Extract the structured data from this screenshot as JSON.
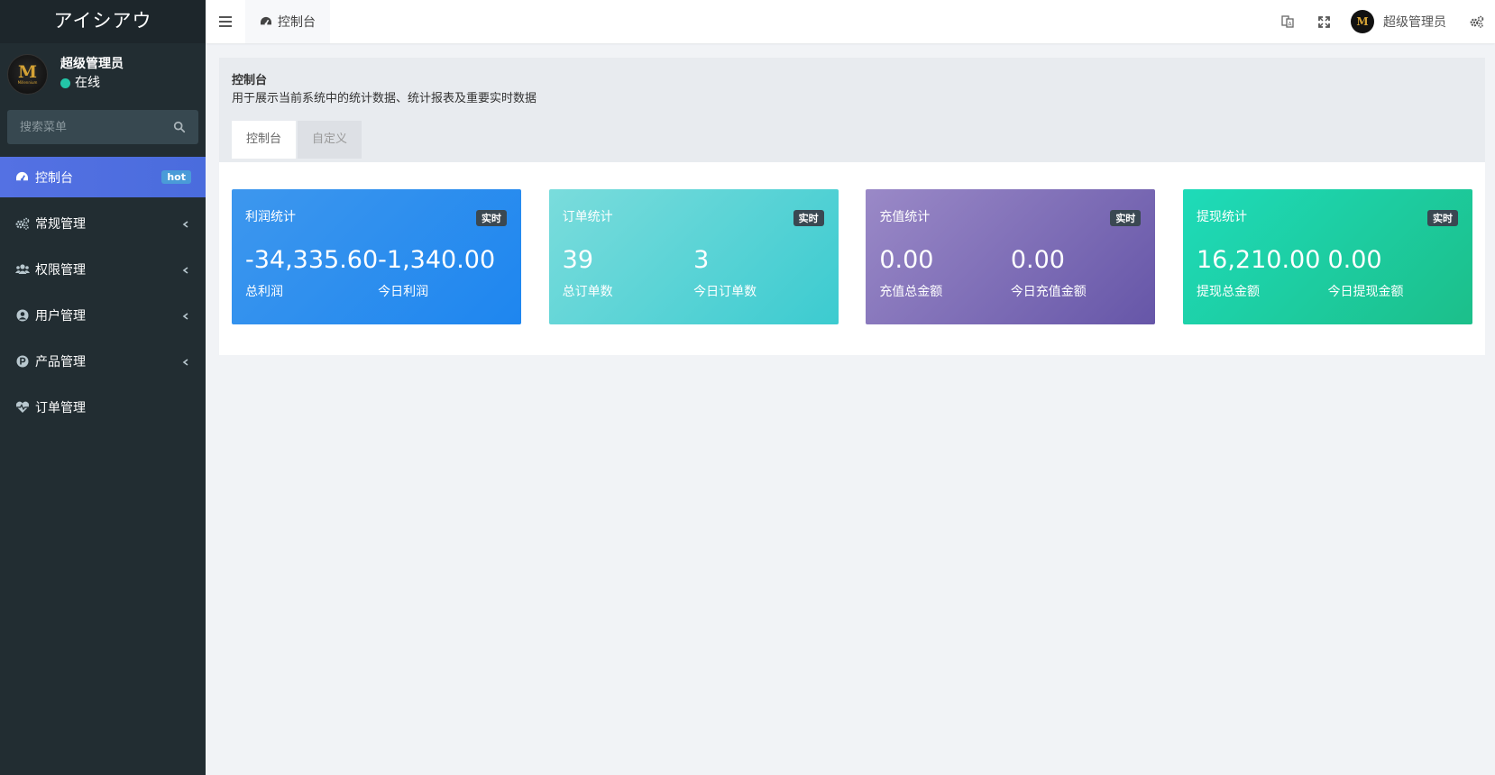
{
  "app": {
    "title": "アイシアウ"
  },
  "user": {
    "name": "超级管理员",
    "status": "在线",
    "avatar_letter": "M",
    "avatar_subtext": "Millennium"
  },
  "search": {
    "placeholder": "搜索菜单"
  },
  "sidebar": {
    "items": [
      {
        "label": "控制台",
        "icon": "dashboard-icon",
        "badge": "hot",
        "active": true
      },
      {
        "label": "常规管理",
        "icon": "cogs-icon",
        "has_children": true
      },
      {
        "label": "权限管理",
        "icon": "group-icon",
        "has_children": true
      },
      {
        "label": "用户管理",
        "icon": "user-circle-icon",
        "has_children": true
      },
      {
        "label": "产品管理",
        "icon": "product-p-icon",
        "has_children": true
      },
      {
        "label": "订单管理",
        "icon": "heartbeat-icon"
      }
    ]
  },
  "header": {
    "tab_label": "控制台",
    "user_name": "超级管理员"
  },
  "panel": {
    "title": "控制台",
    "description": "用于展示当前系统中的统计数据、统计报表及重要实时数据",
    "tabs": [
      "控制台",
      "自定义"
    ]
  },
  "cards": [
    {
      "title": "利润统计",
      "tag": "实时",
      "stats": [
        {
          "value": "-34,335.60",
          "label": "总利润"
        },
        {
          "value": "-1,340.00",
          "label": "今日利润"
        }
      ],
      "color": "#2a8ef0"
    },
    {
      "title": "订单统计",
      "tag": "实时",
      "stats": [
        {
          "value": "39",
          "label": "总订单数"
        },
        {
          "value": "3",
          "label": "今日订单数"
        }
      ],
      "color": "#4ccfd3"
    },
    {
      "title": "充值统计",
      "tag": "实时",
      "stats": [
        {
          "value": "0.00",
          "label": "充值总金额"
        },
        {
          "value": "0.00",
          "label": "今日充值金额"
        }
      ],
      "color": "#7a6bb5"
    },
    {
      "title": "提现统计",
      "tag": "实时",
      "stats": [
        {
          "value": "16,210.00",
          "label": "提现总金额"
        },
        {
          "value": "0.00",
          "label": "今日提现金额"
        }
      ],
      "color": "#1dcca0"
    }
  ],
  "colors": {
    "sidebar_bg": "#222d32",
    "active_menu": "#4c6fe0",
    "badge": "#4a9bd8",
    "online": "#23c6a8"
  }
}
